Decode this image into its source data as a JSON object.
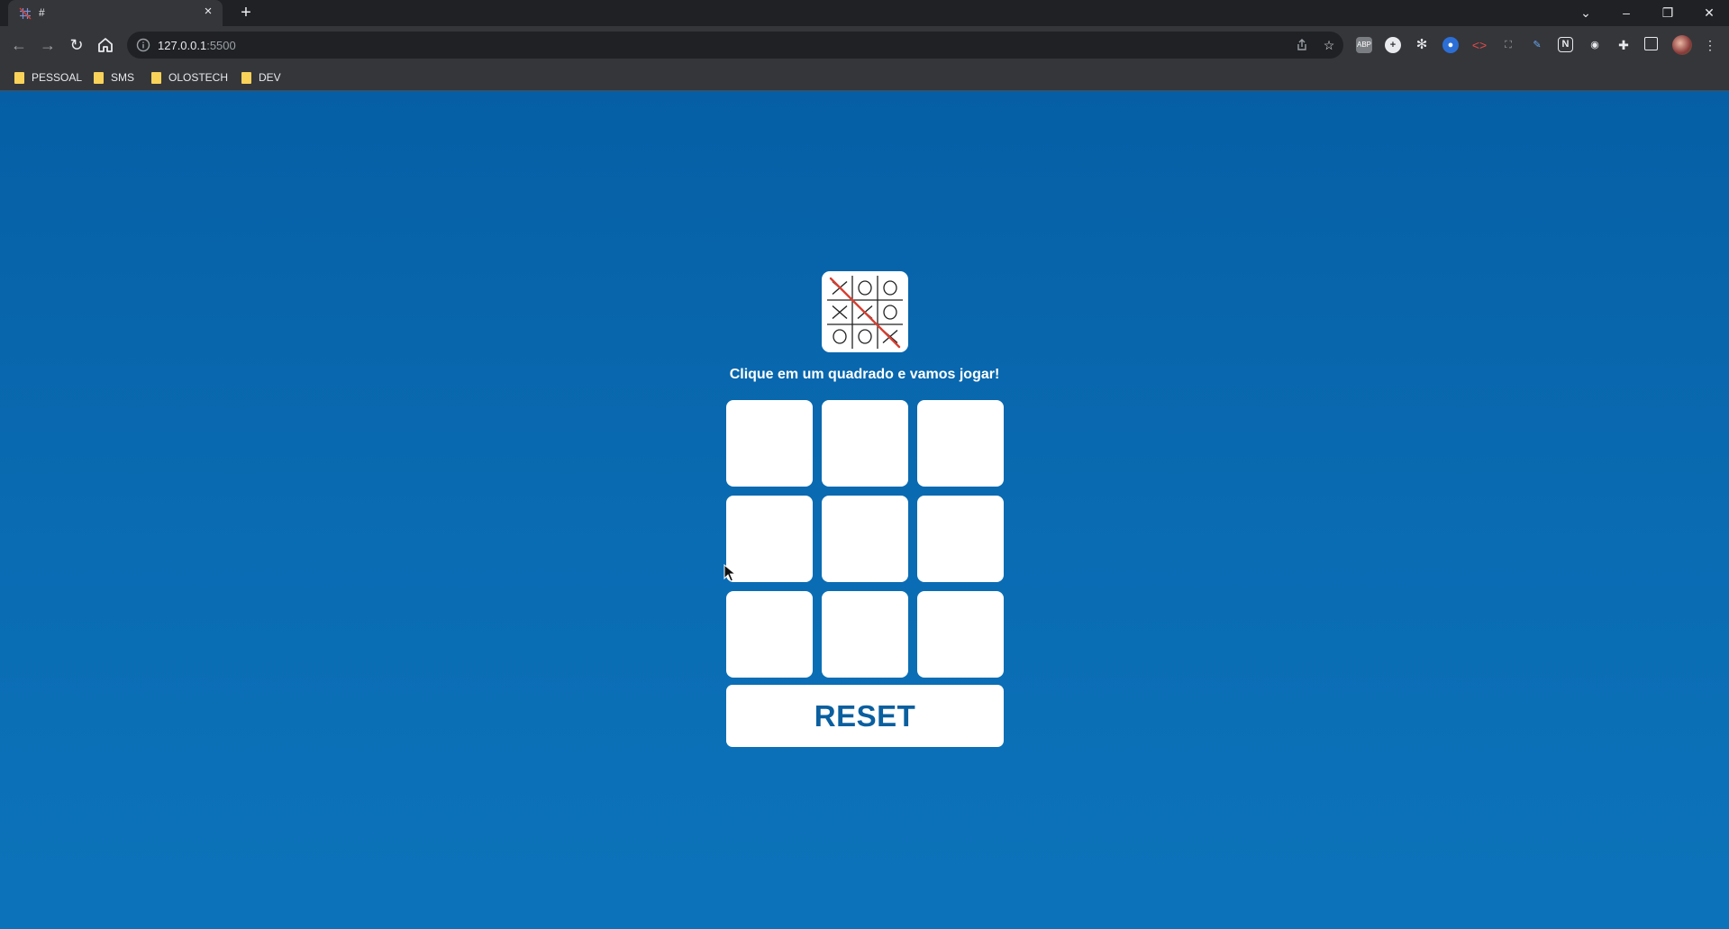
{
  "browser": {
    "tab": {
      "title": "#",
      "close_icon": "×"
    },
    "new_tab_icon": "+",
    "address": {
      "host": "127.0.0.1",
      "port": ":5500"
    },
    "window_controls": {
      "minimize": "–",
      "restore": "❐",
      "close": "✕",
      "tab_search": "⌄"
    },
    "bookmarks": [
      "PESSOAL",
      "SMS",
      "OLOSTECH",
      "DEV"
    ]
  },
  "game": {
    "subtitle": "Clique em um quadrado e vamos jogar!",
    "board": [
      "",
      "",
      "",
      "",
      "",
      "",
      "",
      "",
      ""
    ],
    "reset_label": "RESET",
    "logo": {
      "cells": [
        "X",
        "O",
        "O",
        "X",
        "X",
        "O",
        "O",
        "O",
        "X"
      ],
      "win_line_color": "#d64032"
    }
  },
  "colors": {
    "page_bg": "#0a6cb3",
    "cell_bg": "#ffffff",
    "reset_text": "#0a5f9f"
  }
}
